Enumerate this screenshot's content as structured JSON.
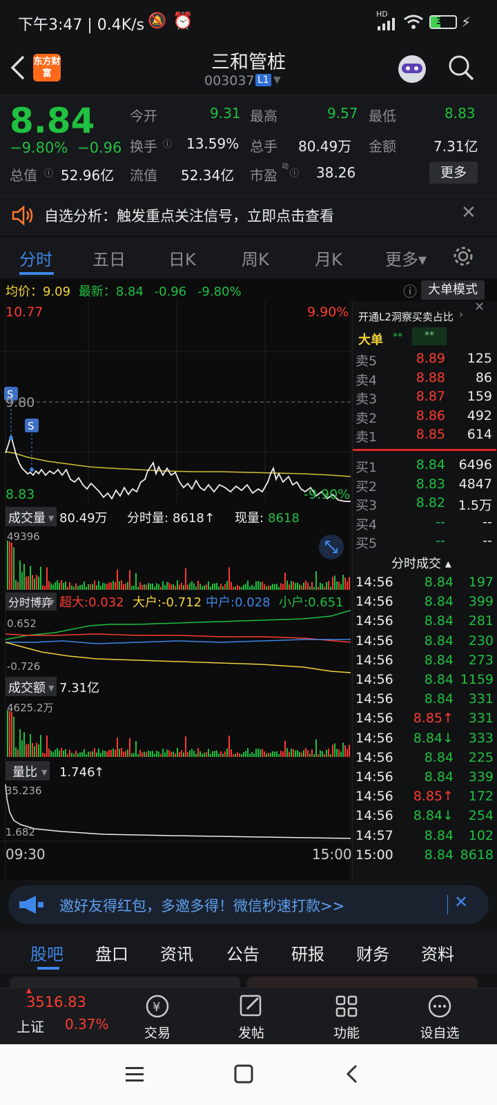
{
  "status": {
    "time": "下午3:47 | 0.4K/s",
    "battery": "33",
    "network": "HD"
  },
  "header": {
    "title": "三和管桩",
    "code": "003037",
    "level": "L1",
    "logo_text": "东方财富"
  },
  "quote": {
    "price": "8.84",
    "pct": "−9.80%",
    "chg": "−0.96",
    "fields": [
      {
        "label": "今开",
        "value": "9.31"
      },
      {
        "label": "最高",
        "value": "9.57"
      },
      {
        "label": "最低",
        "value": "8.83"
      },
      {
        "label": "换手",
        "value": "13.59%"
      },
      {
        "label": "总手",
        "value": "80.49万"
      },
      {
        "label": "金额",
        "value": "7.31亿"
      },
      {
        "label": "总值",
        "value": "52.96亿"
      },
      {
        "label": "流值",
        "value": "52.34亿"
      },
      {
        "label": "市盈",
        "value": "38.26"
      }
    ],
    "more": "更多",
    "pe_sup": "动"
  },
  "notice": {
    "text": "自选分析：触发重点关注信号，立即点击查看"
  },
  "tabs": [
    "分时",
    "五日",
    "日K",
    "周K",
    "月K",
    "更多▾"
  ],
  "avgline": {
    "avg_label": "均价：",
    "avg": "9.09",
    "new_label": "最新：",
    "new": "8.84",
    "chg": "-0.96",
    "pct": "-9.80%",
    "mode": "大单模式"
  },
  "chart": {
    "top_price": "10.77",
    "top_pct": "9.90%",
    "bottom_price": "8.83",
    "bottom_pct": "-9.90%",
    "ref_price": "9.80",
    "marker": "S",
    "time_start": "09:30",
    "time_end": "15:00"
  },
  "volume": {
    "label": "成交量",
    "value": "80.49万",
    "fs_label": "分时量:",
    "fs_value": "8618",
    "now_label": "现量:",
    "now_value": "8618",
    "max": "49396"
  },
  "bobo": {
    "label": "分时博弈",
    "super": "超大:0.032",
    "big": "大户:-0.712",
    "mid": "中户:0.028",
    "small": "小户:0.651",
    "top": "0.652",
    "bottom": "-0.726"
  },
  "amount": {
    "label": "成交额",
    "value": "7.31亿",
    "max": "4625.2万"
  },
  "ratio": {
    "label": "量比",
    "value": "1.746",
    "top": "35.236",
    "bottom": "1.682"
  },
  "orderbook": {
    "l2": "开通L2洞察买卖占比",
    "dadan": "大单",
    "stars": "**",
    "sells": [
      {
        "l": "卖5",
        "p": "8.89",
        "v": "125"
      },
      {
        "l": "卖4",
        "p": "8.88",
        "v": "86"
      },
      {
        "l": "卖3",
        "p": "8.87",
        "v": "159"
      },
      {
        "l": "卖2",
        "p": "8.86",
        "v": "492"
      },
      {
        "l": "卖1",
        "p": "8.85",
        "v": "614"
      }
    ],
    "buys": [
      {
        "l": "买1",
        "p": "8.84",
        "v": "6496"
      },
      {
        "l": "买2",
        "p": "8.83",
        "v": "4847"
      },
      {
        "l": "买3",
        "p": "8.82",
        "v": "1.5万"
      },
      {
        "l": "买4",
        "p": "--",
        "v": "--"
      },
      {
        "l": "买5",
        "p": "--",
        "v": "--"
      }
    ],
    "ticks_title": "分时成交 ▴",
    "ticks": [
      {
        "t": "14:56",
        "p": "8.84",
        "v": "197",
        "c": "green"
      },
      {
        "t": "14:56",
        "p": "8.84",
        "v": "399",
        "c": "green"
      },
      {
        "t": "14:56",
        "p": "8.84",
        "v": "281",
        "c": "green"
      },
      {
        "t": "14:56",
        "p": "8.84",
        "v": "230",
        "c": "green"
      },
      {
        "t": "14:56",
        "p": "8.84",
        "v": "273",
        "c": "green"
      },
      {
        "t": "14:56",
        "p": "8.84",
        "v": "1159",
        "c": "green"
      },
      {
        "t": "14:56",
        "p": "8.84",
        "v": "331",
        "c": "green"
      },
      {
        "t": "14:56",
        "p": "8.85↑",
        "v": "331",
        "c": "red"
      },
      {
        "t": "14:56",
        "p": "8.84↓",
        "v": "333",
        "c": "green"
      },
      {
        "t": "14:56",
        "p": "8.84",
        "v": "225",
        "c": "green"
      },
      {
        "t": "14:56",
        "p": "8.84",
        "v": "339",
        "c": "green"
      },
      {
        "t": "14:56",
        "p": "8.85↑",
        "v": "172",
        "c": "red"
      },
      {
        "t": "14:56",
        "p": "8.84↓",
        "v": "254",
        "c": "green"
      },
      {
        "t": "14:57",
        "p": "8.84",
        "v": "102",
        "c": "green"
      },
      {
        "t": "15:00",
        "p": "8.84",
        "v": "8618",
        "c": "green"
      }
    ]
  },
  "banner": {
    "text": "邀好友得红包，多邀多得！微信秒速打款>>"
  },
  "bottomtabs": [
    "股吧",
    "盘口",
    "资讯",
    "公告",
    "研报",
    "财务",
    "资料"
  ],
  "dock": {
    "index_value": "3516.83",
    "index_name": "上证",
    "index_pct": "0.37%",
    "items": [
      "交易",
      "发帖",
      "功能",
      "设自选"
    ]
  },
  "colors": {
    "up": "#ff3b30",
    "down": "#20c040",
    "accent": "#3e86e8",
    "avg_line": "#f1d33a"
  }
}
